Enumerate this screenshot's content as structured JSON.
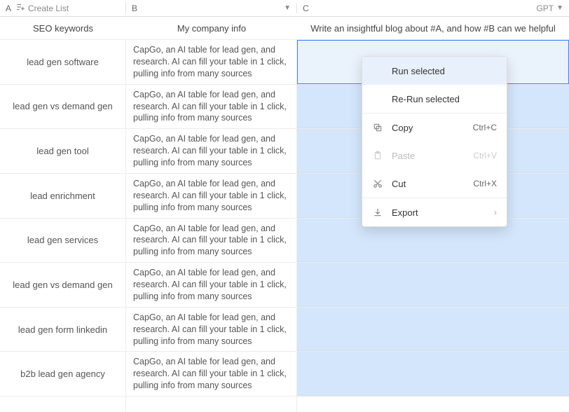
{
  "header": {
    "colA": "A",
    "createList": "Create List",
    "colB": "B",
    "colC": "C",
    "gpt": "GPT"
  },
  "titles": {
    "a": "SEO keywords",
    "b": "My company info",
    "c": "Write an insightful blog about #A, and how #B can we helpful"
  },
  "cellB_text": "CapGo, an AI table for lead gen, and research. AI can fill your table in 1 click, pulling info from many sources",
  "rows": [
    "lead gen software",
    "lead gen vs demand gen",
    "lead gen tool",
    "lead enrichment",
    "lead gen services",
    "lead gen vs demand gen",
    "lead gen form linkedin",
    "b2b lead gen agency"
  ],
  "menu": {
    "run": "Run selected",
    "rerun": "Re-Run selected",
    "copy": "Copy",
    "copy_sc": "Ctrl+C",
    "paste": "Paste",
    "paste_sc": "Ctrl+V",
    "cut": "Cut",
    "cut_sc": "Ctrl+X",
    "export": "Export"
  }
}
